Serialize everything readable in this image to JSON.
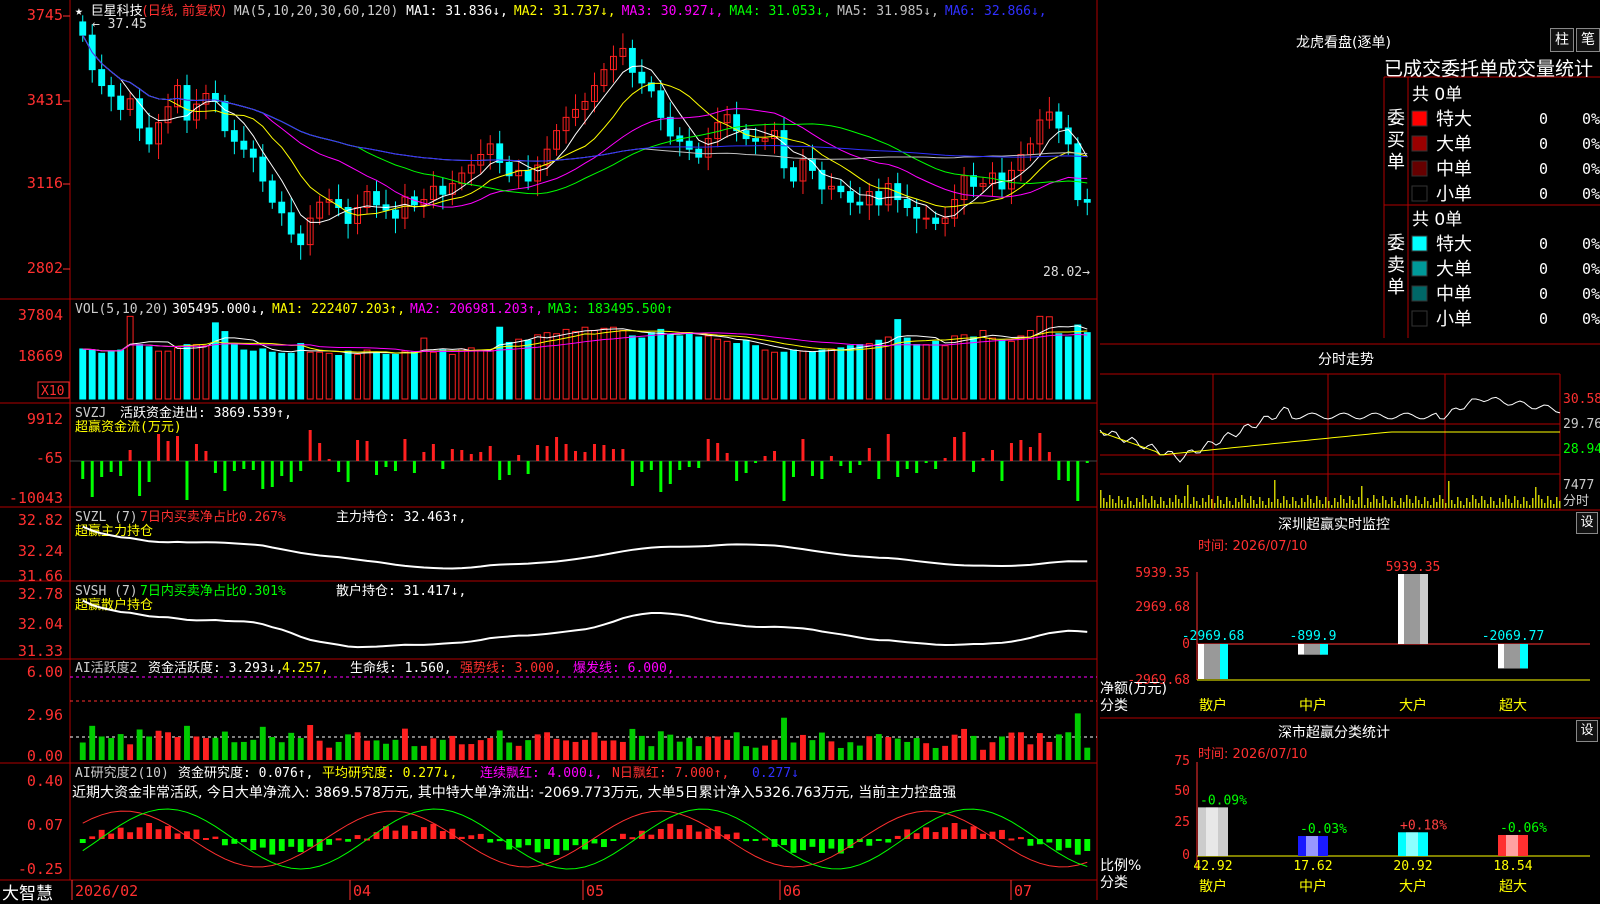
{
  "app": {
    "name": "大智慧"
  },
  "stock": {
    "name": "巨星科技",
    "mode": "(日线, 前复权)"
  },
  "main_chart": {
    "ma_header": "MA(5,10,20,30,60,120)",
    "ma": [
      {
        "label": "MA1: 31.836",
        "arrow": "↓",
        "color": "#ffffff"
      },
      {
        "label": "MA2: 31.737",
        "arrow": "↓",
        "color": "#ffff00"
      },
      {
        "label": "MA3: 30.927",
        "arrow": "↓",
        "color": "#ff00ff"
      },
      {
        "label": "MA4: 31.053",
        "arrow": "↓",
        "color": "#00ff00"
      },
      {
        "label": "MA5: 31.985",
        "arrow": "↓",
        "color": "#c0c0c0"
      },
      {
        "label": "MA6: 32.866",
        "arrow": "↓",
        "color": "#3030ff"
      }
    ],
    "y_labels": [
      "3745",
      "3431",
      "3116",
      "2802"
    ],
    "high_label": "37.45",
    "low_label": "28.02"
  },
  "vol_panel": {
    "label": "VOL(5,10,20)",
    "value": "305495.000",
    "ma1": "MA1: 222407.203",
    "ma2": "MA2: 206981.203",
    "ma3": "MA3: 183495.500",
    "y_labels": [
      "37804",
      "18669"
    ],
    "unit": "X10"
  },
  "svzj_panel": {
    "label": "SVZJ",
    "title": "活跃资金进出: 3869.539",
    "sub": "超赢资金流(万元)",
    "y_labels": [
      "9912",
      "-65",
      "-10043"
    ]
  },
  "svzl_panel": {
    "label": "SVZL (7)",
    "ratio": "7日内买卖净占比0.267%",
    "hold": "主力持仓: 32.463",
    "sub": "超赢主力持仓",
    "y_labels": [
      "32.82",
      "32.24",
      "31.66"
    ]
  },
  "svsh_panel": {
    "label": "SVSH (7)",
    "ratio": "7日内买卖净占比0.301%",
    "hold": "散户持仓: 31.417",
    "sub": "超赢散户持仓",
    "y_labels": [
      "32.78",
      "32.04",
      "31.33"
    ]
  },
  "ai_active": {
    "label": "AI活跃度2",
    "activity": "资金活跃度: 3.293",
    "v2": "4.257,",
    "life": "生命线: 1.560,",
    "strong": "强势线: 3.000,",
    "burst": "爆发线: 6.000,",
    "y_labels": [
      "6.00",
      "2.96",
      "0.00"
    ]
  },
  "ai_research": {
    "label": "AI研究度2(10)",
    "research": "资金研究度: 0.076",
    "avg": "平均研究度: 0.277",
    "consec": "连续飘红: 4.000",
    "nday": "N日飘红: 7.000",
    "v5": "0.277",
    "summary": "近期大资金非常活跃, 今日大单净流入: 3869.578万元, 其中特大单净流出: -2069.773万元, 大单5日累计净入5326.763万元, 当前主力控盘强",
    "y_labels": [
      "0.40",
      "0.07",
      "-0.25"
    ]
  },
  "x_axis": {
    "labels": [
      "2026/02",
      "04",
      "05",
      "06",
      "07"
    ]
  },
  "right": {
    "dragon_title": "龙虎看盘(逐单)",
    "btn_bar": "柱",
    "btn_pen": "笔",
    "trade_title": "已成交委托单成交量统计",
    "buy": {
      "side": "委买单",
      "total": "共 0单",
      "rows": [
        {
          "label": "特大",
          "count": "0",
          "pct": "0%",
          "color": "#ff0000"
        },
        {
          "label": "大单",
          "count": "0",
          "pct": "0%",
          "color": "#990000"
        },
        {
          "label": "中单",
          "count": "0",
          "pct": "0%",
          "color": "#660000"
        },
        {
          "label": "小单",
          "count": "0",
          "pct": "0%",
          "color": "#000000"
        }
      ]
    },
    "sell": {
      "side": "委卖单",
      "total": "共 0单",
      "rows": [
        {
          "label": "特大",
          "count": "0",
          "pct": "0%",
          "color": "#00ffff"
        },
        {
          "label": "大单",
          "count": "0",
          "pct": "0%",
          "color": "#009999"
        },
        {
          "label": "中单",
          "count": "0",
          "pct": "0%",
          "color": "#006666"
        },
        {
          "label": "小单",
          "count": "0",
          "pct": "0%",
          "color": "#000000"
        }
      ]
    },
    "intraday": {
      "title": "分时走势",
      "y_labels": [
        "30.58",
        "29.76",
        "28.94"
      ],
      "vol_top": "7477",
      "vol_unit": "分时"
    },
    "monitor": {
      "title": "深圳超赢实时监控",
      "time": "时间: 2026/07/10",
      "btn": "设",
      "y_labels": [
        "5939.35",
        "2969.68",
        "0",
        "-2969.68"
      ],
      "ylabel": "净额(万元)",
      "xlabel": "分类",
      "bars": [
        {
          "cat": "散户",
          "value": -2969.68,
          "label": "-2969.68"
        },
        {
          "cat": "中户",
          "value": -899.9,
          "label": "-899.9"
        },
        {
          "cat": "大户",
          "value": 5939.35,
          "label": "5939.35"
        },
        {
          "cat": "超大",
          "value": -2069.77,
          "label": "-2069.77"
        }
      ]
    },
    "classify": {
      "title": "深市超赢分类统计",
      "time": "时间: 2026/07/10",
      "btn": "设",
      "y_labels": [
        "75",
        "50",
        "25",
        "0"
      ],
      "ylabel": "比例%",
      "xlabel": "分类",
      "bars": [
        {
          "cat": "散户",
          "value": 42.92,
          "label": "42.92",
          "delta": "-0.09%",
          "color": "#cccccc",
          "dcolor": "#00ff00"
        },
        {
          "cat": "中户",
          "value": 17.62,
          "label": "17.62",
          "delta": "-0.03%",
          "color": "#1a1aff",
          "dcolor": "#00ff00"
        },
        {
          "cat": "大户",
          "value": 20.92,
          "label": "20.92",
          "delta": "+0.18%",
          "color": "#00ffff",
          "dcolor": "#ff4040"
        },
        {
          "cat": "超大",
          "value": 18.54,
          "label": "18.54",
          "delta": "-0.06%",
          "color": "#ff3030",
          "dcolor": "#00ff00"
        }
      ]
    }
  },
  "colors": {
    "up": "#ff2020",
    "down": "#00ffff",
    "grid": "#b00000"
  },
  "chart_data": {
    "type": "candlestick",
    "ylim": [
      28.02,
      37.45
    ],
    "close": [
      36.5,
      35.2,
      34.6,
      34.2,
      33.7,
      34.1,
      33.0,
      32.4,
      33.2,
      33.8,
      34.6,
      33.3,
      33.9,
      34.3,
      34.0,
      32.9,
      32.5,
      32.2,
      31.9,
      31.0,
      30.2,
      29.8,
      29.0,
      28.6,
      29.6,
      30.2,
      30.3,
      30.0,
      29.4,
      30.0,
      30.6,
      30.1,
      29.9,
      29.6,
      30.4,
      30.1,
      30.3,
      30.8,
      30.5,
      30.9,
      31.3,
      31.6,
      32.0,
      32.4,
      31.7,
      31.2,
      31.4,
      31.0,
      31.6,
      32.2,
      32.9,
      33.4,
      33.7,
      34.0,
      34.6,
      35.2,
      35.7,
      36.0,
      35.1,
      34.7,
      34.4,
      33.4,
      32.7,
      32.5,
      32.2,
      31.9,
      32.6,
      33.2,
      33.5,
      32.9,
      32.6,
      32.5,
      32.6,
      32.9,
      31.5,
      31.0,
      31.8,
      31.4,
      30.7,
      30.8,
      30.6,
      30.2,
      30.1,
      30.6,
      30.1,
      30.9,
      30.3,
      30.0,
      29.6,
      29.6,
      29.4,
      29.6,
      30.3,
      31.2,
      30.8,
      30.9,
      31.3,
      30.7,
      31.4,
      32.0,
      32.4,
      33.3,
      33.6,
      33.0,
      32.4,
      30.3,
      30.2
    ],
    "volume": [
      23000,
      22500,
      21000,
      22000,
      22500,
      38000,
      25000,
      24000,
      22000,
      22000,
      23500,
      25000,
      25000,
      24500,
      35000,
      31000,
      25000,
      22500,
      22000,
      23000,
      21500,
      21000,
      21000,
      25500,
      21500,
      21500,
      21000,
      20000,
      22000,
      20500,
      22500,
      21500,
      20500,
      20500,
      22000,
      21500,
      28000,
      21500,
      22500,
      20500,
      23000,
      23500,
      22500,
      22500,
      33000,
      26000,
      27500,
      27000,
      29500,
      30500,
      30000,
      32000,
      31000,
      33000,
      31500,
      32500,
      33000,
      31500,
      29000,
      28000,
      30500,
      32000,
      29500,
      29000,
      30500,
      28500,
      29000,
      27500,
      26500,
      25500,
      27000,
      24500,
      22500,
      21500,
      21500,
      22500,
      22000,
      21500,
      22500,
      23000,
      23500,
      24500,
      25000,
      25500,
      27000,
      28500,
      36500,
      28000,
      25000,
      25000,
      26500,
      24500,
      29000,
      29500,
      28500,
      31500,
      28000,
      27000,
      26500,
      29000,
      31500,
      38000,
      37804,
      30000,
      28500,
      34000,
      30500
    ]
  }
}
